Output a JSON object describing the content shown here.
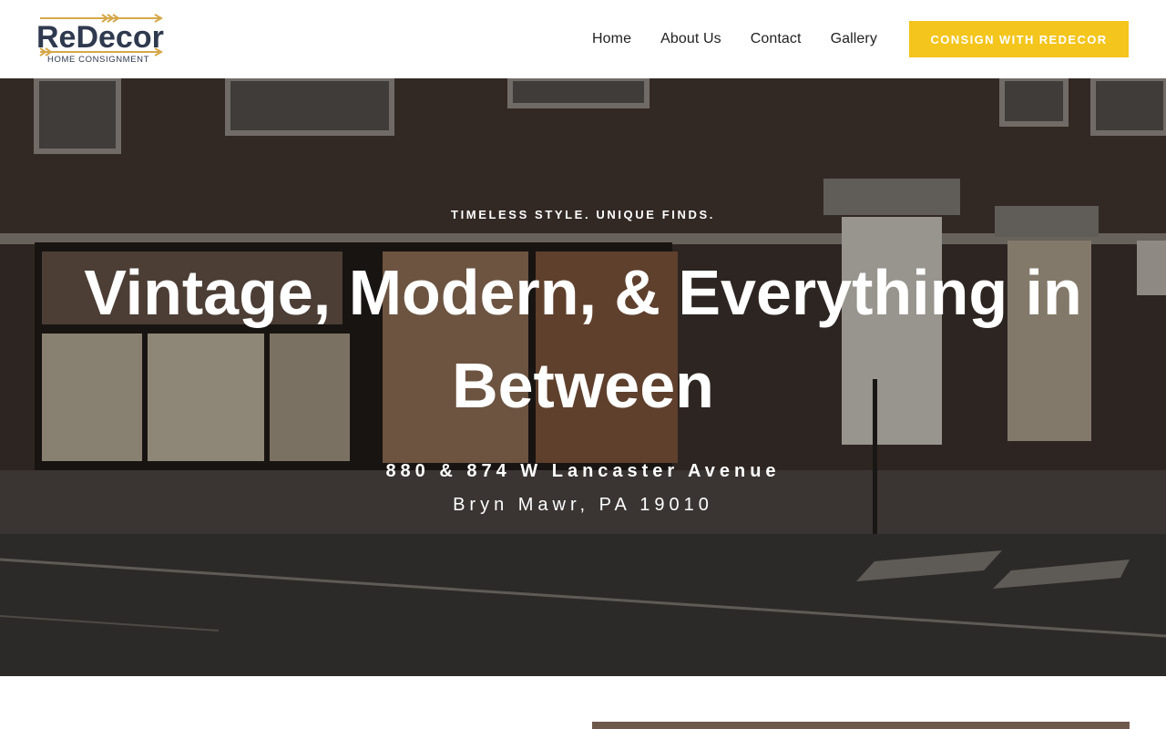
{
  "brand": {
    "name": "ReDecor",
    "tagline": "HOME CONSIGNMENT",
    "colors": {
      "accent": "#f4c51c",
      "brand_text": "#2f3a4f",
      "arrow": "#d4a84a"
    }
  },
  "nav": {
    "items": [
      {
        "label": "Home"
      },
      {
        "label": "About Us"
      },
      {
        "label": "Contact"
      },
      {
        "label": "Gallery"
      }
    ],
    "cta_label": "CONSIGN WITH REDECOR"
  },
  "hero": {
    "eyebrow": "TIMELESS STYLE. UNIQUE FINDS.",
    "title": "Vintage, Modern, & Everything in Between",
    "address_line1": "880 & 874 W Lancaster Avenue",
    "address_line2": "Bryn Mawr, PA 19010"
  }
}
